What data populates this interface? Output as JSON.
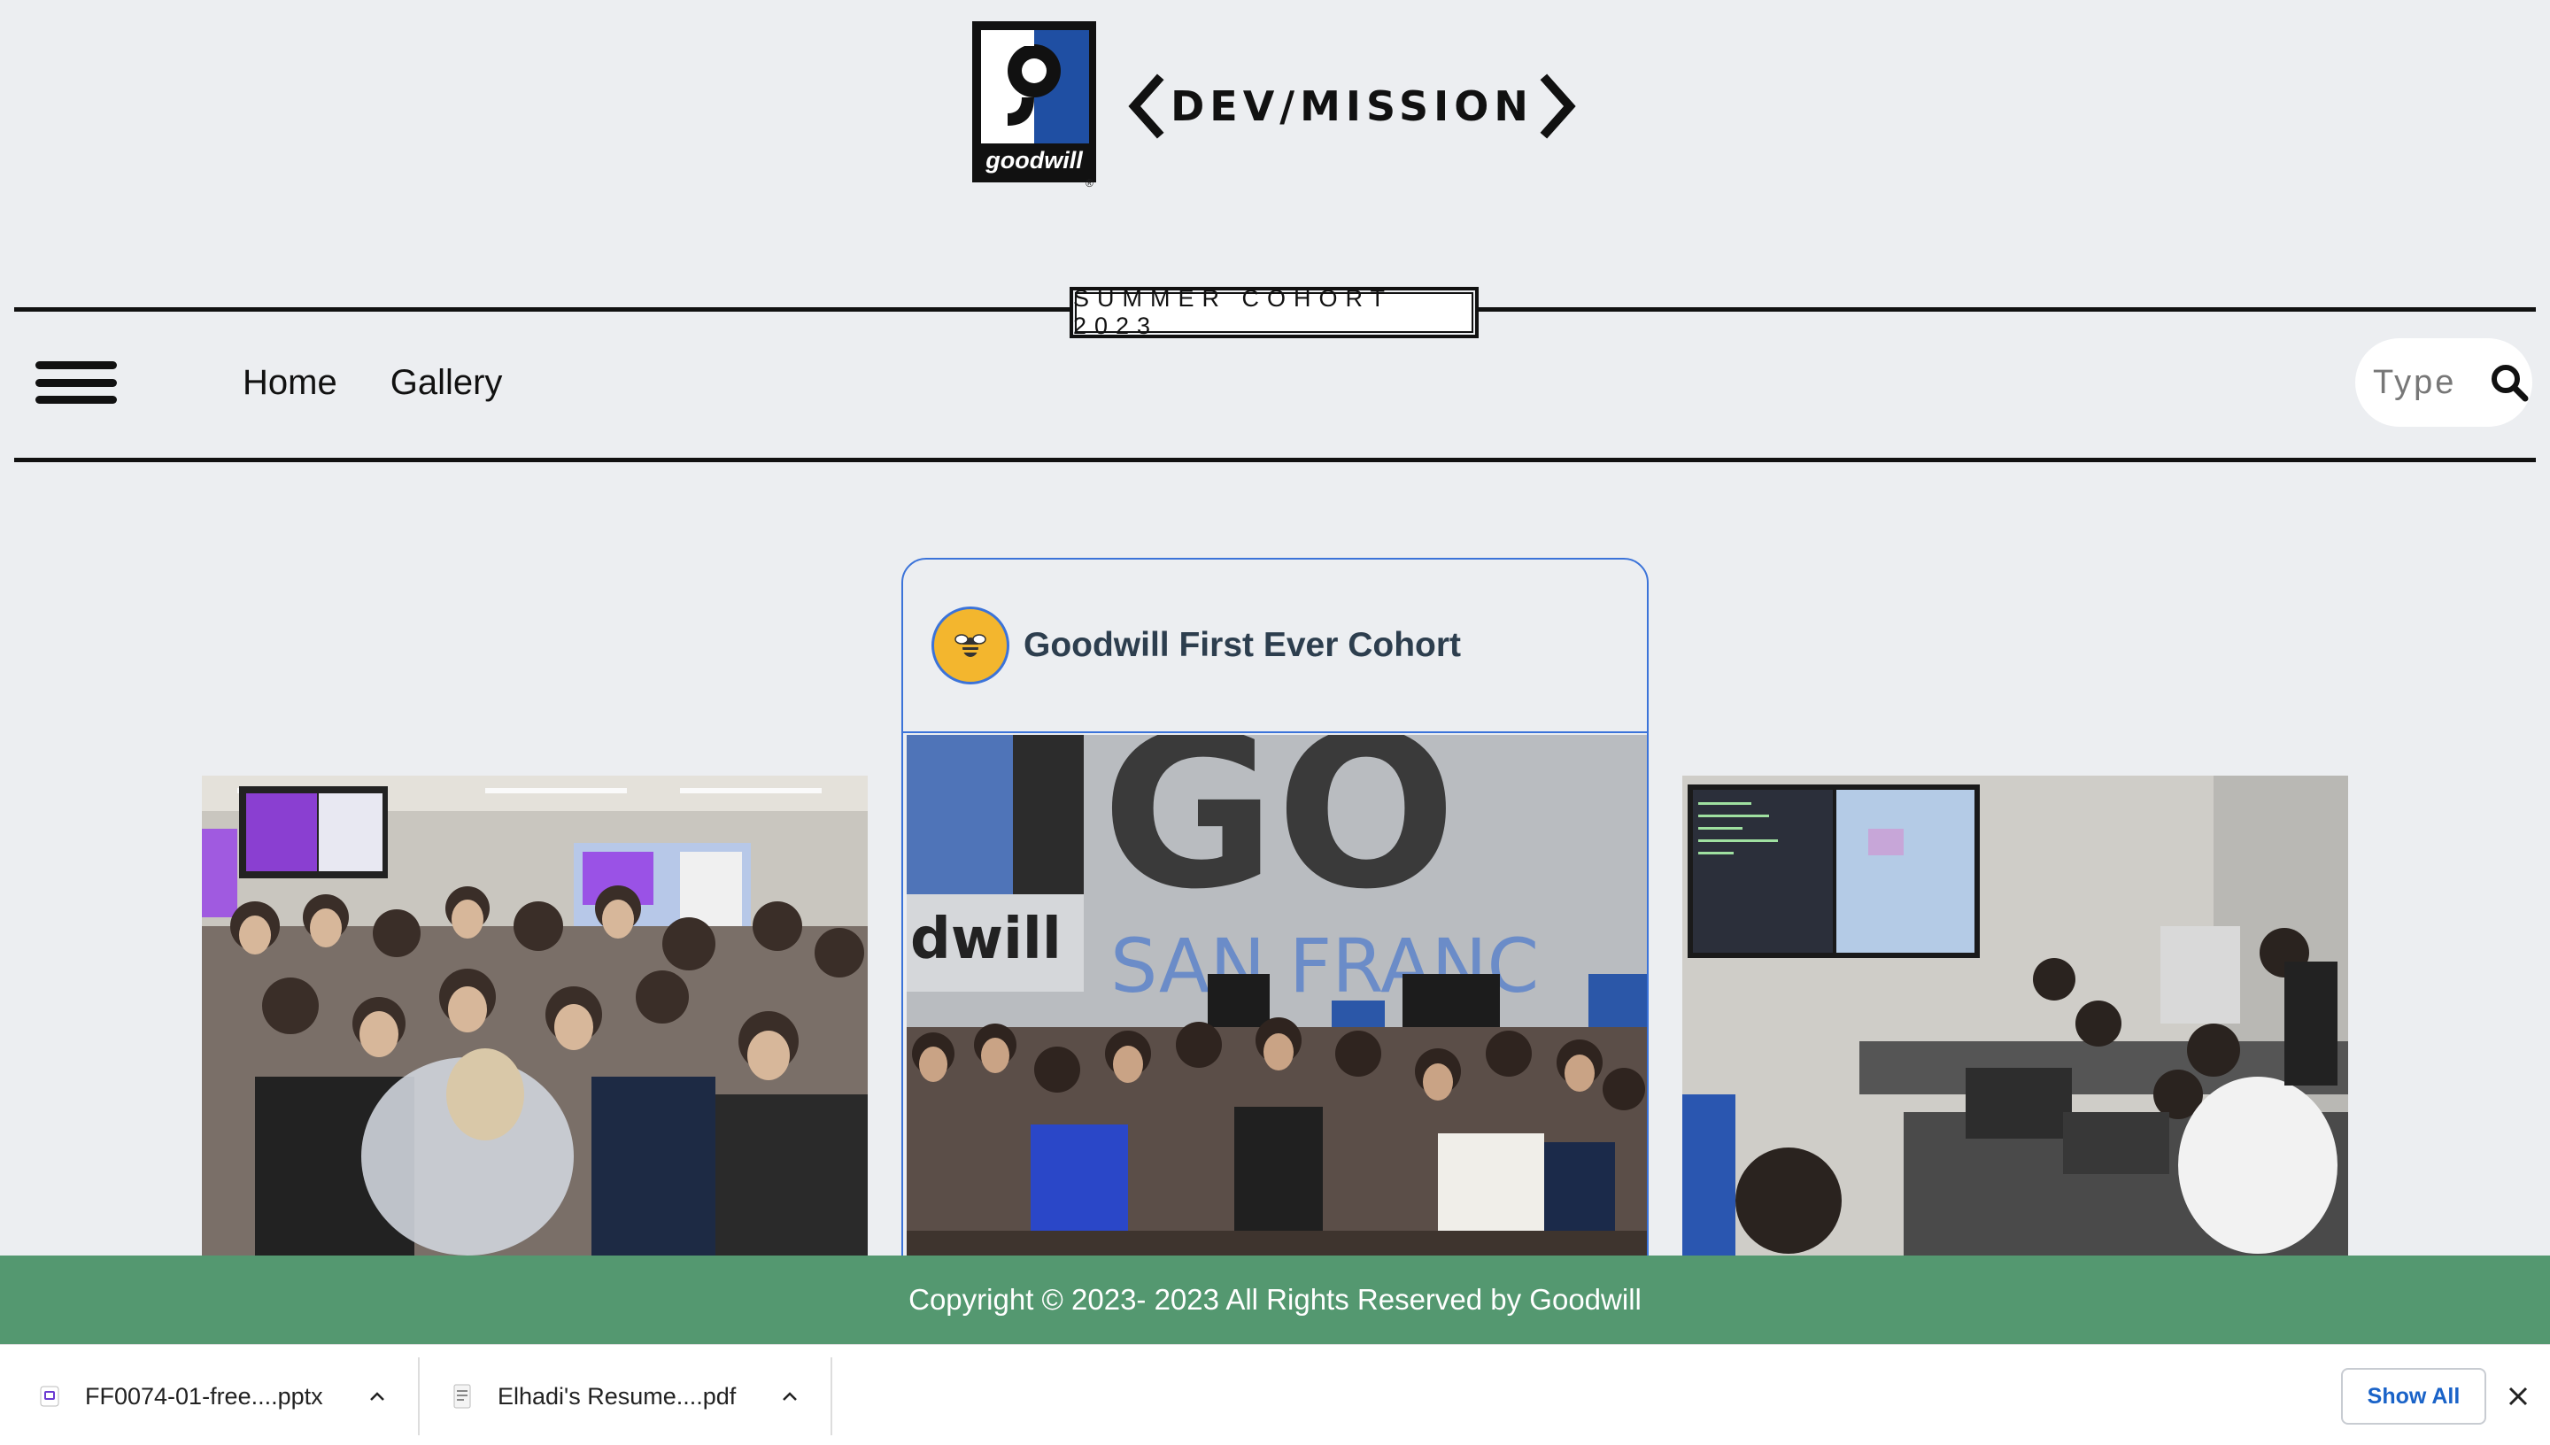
{
  "header": {
    "goodwill_logo_text": "goodwill",
    "dev_mission_logo_text": "DEV/MISSION",
    "cohort_badge": "SUMMER COHORT 2023"
  },
  "nav": {
    "links": [
      {
        "label": "Home"
      },
      {
        "label": "Gallery"
      }
    ],
    "search_placeholder": "Type",
    "icons": [
      "hamburger-menu-icon",
      "search-icon"
    ]
  },
  "gallery": {
    "featured": {
      "title": "Goodwill First Ever Cohort",
      "avatar_icon": "bee-icon",
      "photo_wall_text": [
        "dwill",
        "GO",
        "SAN FRANC"
      ]
    },
    "left_photo_icon": "group-photo",
    "right_photo_icon": "classroom-photo"
  },
  "footer": {
    "copyright": "Copyright © 2023- 2023 All Rights Reserved by Goodwill"
  },
  "downloads": {
    "items": [
      {
        "name": "FF0074-01-free....pptx",
        "icon": "pptx-file-icon"
      },
      {
        "name": "Elhadi's Resume....pdf",
        "icon": "pdf-file-icon"
      }
    ],
    "show_all_label": "Show All"
  },
  "colors": {
    "page_bg": "#eceef1",
    "footer_bg": "#549870",
    "card_border": "#3b73d9",
    "goodwill_blue": "#1f4fa3",
    "avatar_bg": "#f3b62e",
    "link_blue": "#1a63c8"
  }
}
